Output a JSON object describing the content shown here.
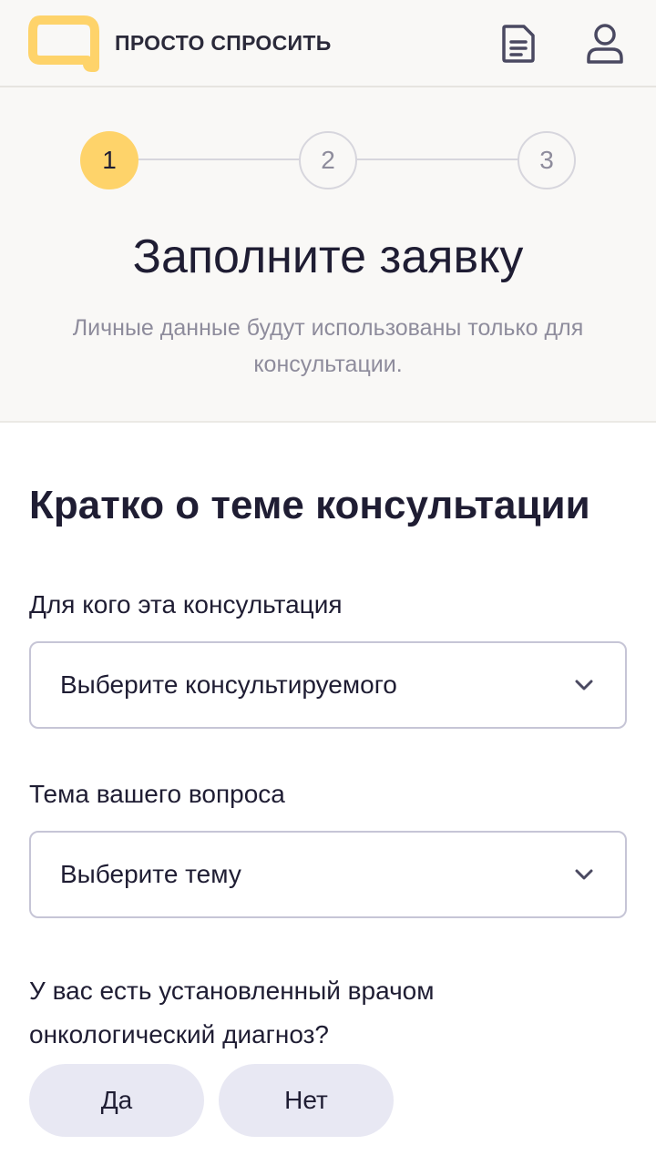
{
  "header": {
    "logo_text": "ПРОСТО СПРОСИТЬ",
    "logo_icon": "speech-bubble-icon",
    "doc_icon": "document-icon",
    "user_icon": "user-icon"
  },
  "stepper": {
    "steps": [
      "1",
      "2",
      "3"
    ],
    "active_step": 1
  },
  "intro": {
    "title": "Заполните заявку",
    "subtitle": "Личные данные будут использованы только для консультации."
  },
  "form": {
    "section_title": "Кратко о теме консультации",
    "for_whom": {
      "label": "Для кого эта консультация",
      "placeholder": "Выберите консультируемого"
    },
    "topic": {
      "label": "Тема вашего вопроса",
      "placeholder": "Выберите тему"
    },
    "diagnosis": {
      "question": "У вас есть установленный врачом онкологический диагноз?",
      "yes_label": "Да",
      "no_label": "Нет"
    }
  },
  "colors": {
    "accent": "#fed36a",
    "background": "#f9f8f6",
    "text": "#1f1d33",
    "muted": "#8e8c9c",
    "pill": "#e8e8f3"
  }
}
